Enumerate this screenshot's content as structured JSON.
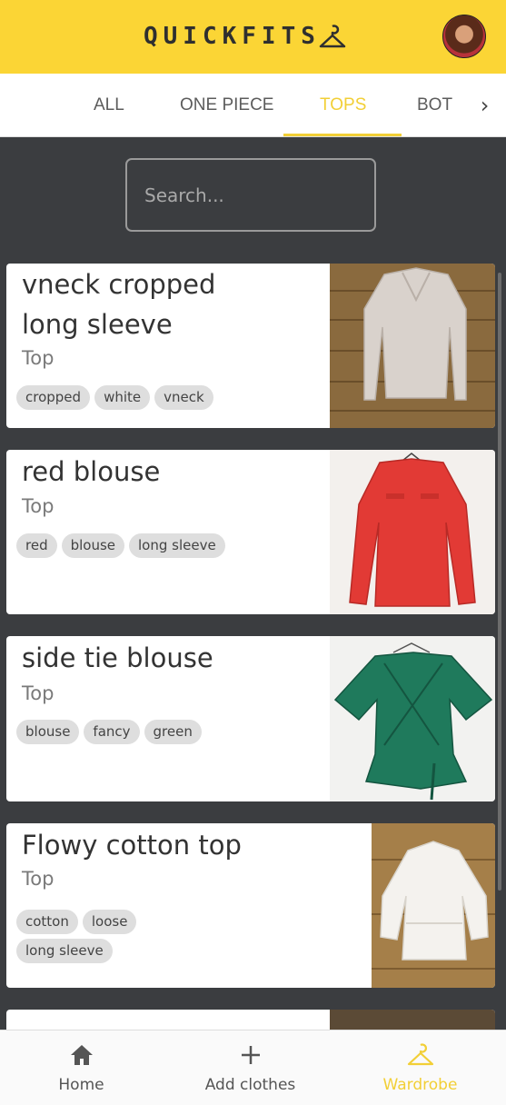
{
  "app": {
    "title": "QUICKFITS"
  },
  "tabs": [
    {
      "label": "ALL"
    },
    {
      "label": "ONE PIECE"
    },
    {
      "label": "TOPS"
    },
    {
      "label": "BOT"
    }
  ],
  "active_tab": "TOPS",
  "search": {
    "placeholder": "Search..."
  },
  "items": [
    {
      "title_lines": [
        "vneck cropped",
        "long sleeve"
      ],
      "category": "Top",
      "tags": [
        "cropped",
        "white",
        "vneck"
      ]
    },
    {
      "title_lines": [
        "red blouse"
      ],
      "category": "Top",
      "tags": [
        "red",
        "blouse",
        "long sleeve"
      ]
    },
    {
      "title_lines": [
        "side tie blouse"
      ],
      "category": "Top",
      "tags": [
        "blouse",
        "fancy",
        "green"
      ]
    },
    {
      "title_lines": [
        "Flowy cotton top"
      ],
      "category": "Top",
      "tags": [
        "cotton",
        "loose",
        "long sleeve"
      ]
    }
  ],
  "bottom_nav": [
    {
      "label": "Home",
      "icon": "home-icon"
    },
    {
      "label": "Add clothes",
      "icon": "plus-icon"
    },
    {
      "label": "Wardrobe",
      "icon": "hanger-icon"
    }
  ],
  "active_nav": "Wardrobe",
  "colors": {
    "accent": "#fbd535",
    "active_text": "#f2cf36",
    "background": "#3b3d40"
  }
}
